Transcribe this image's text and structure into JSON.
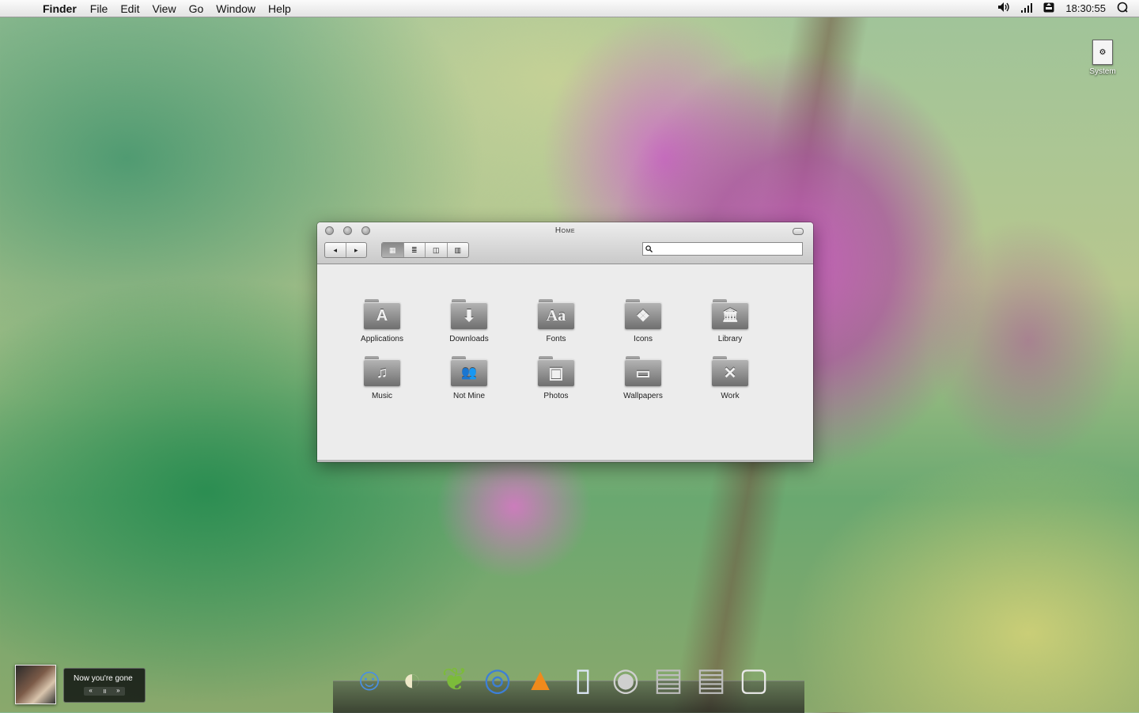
{
  "menubar": {
    "apple_symbol": "",
    "items": [
      "Finder",
      "File",
      "Edit",
      "View",
      "Go",
      "Window",
      "Help"
    ],
    "status": {
      "volume_icon": "volume-icon",
      "signal_icon": "signal-icon",
      "battery_icon": "battery-icon",
      "clock": "18:30:55",
      "spotlight_icon": "spotlight-icon"
    }
  },
  "desktop": {
    "icons": [
      {
        "label": "System",
        "icon": "system-document-icon"
      }
    ]
  },
  "finder": {
    "title": "Home",
    "nav": {
      "back": "◂",
      "forward": "▸"
    },
    "views": [
      {
        "name": "icon-view",
        "glyph": "▦",
        "active": true
      },
      {
        "name": "list-view",
        "glyph": "≣",
        "active": false
      },
      {
        "name": "column-view",
        "glyph": "◫",
        "active": false
      },
      {
        "name": "coverflow-view",
        "glyph": "▥",
        "active": false
      }
    ],
    "search": {
      "placeholder": "",
      "value": "",
      "icon": "magnifier-icon"
    },
    "items": [
      {
        "label": "Applications",
        "glyph": "A"
      },
      {
        "label": "Downloads",
        "glyph": "⬇"
      },
      {
        "label": "Fonts",
        "glyph": "Aa"
      },
      {
        "label": "Icons",
        "glyph": "❖"
      },
      {
        "label": "Library",
        "glyph": "🏛"
      },
      {
        "label": "Music",
        "glyph": "♫"
      },
      {
        "label": "Not Mine",
        "glyph": "👥"
      },
      {
        "label": "Photos",
        "glyph": "▣"
      },
      {
        "label": "Wallpapers",
        "glyph": "▭"
      },
      {
        "label": "Work",
        "glyph": "✕"
      }
    ]
  },
  "now_playing": {
    "song": "Now you're gone",
    "controls": {
      "prev": "«",
      "pause": "॥",
      "next": "»"
    }
  },
  "dock": {
    "apps": [
      {
        "name": "finder",
        "glyph": "☺",
        "color": "#4a8fe0"
      },
      {
        "name": "adium",
        "glyph": "◐",
        "color": "#eee8c8"
      },
      {
        "name": "coda",
        "glyph": "❦",
        "color": "#7cbb3a"
      },
      {
        "name": "safari",
        "glyph": "◎",
        "color": "#3d7fd6"
      },
      {
        "name": "vlc",
        "glyph": "▲",
        "color": "#f08a1c"
      },
      {
        "name": "milk",
        "glyph": "▯",
        "color": "#dce7f7"
      },
      {
        "name": "coffee",
        "glyph": "◉",
        "color": "#cfcfcf"
      },
      {
        "name": "stack-1",
        "glyph": "▤",
        "color": "#bdbdbd"
      },
      {
        "name": "stack-2",
        "glyph": "▤",
        "color": "#bdbdbd"
      },
      {
        "name": "trash",
        "glyph": "▢",
        "color": "#e9e9e9"
      }
    ]
  }
}
